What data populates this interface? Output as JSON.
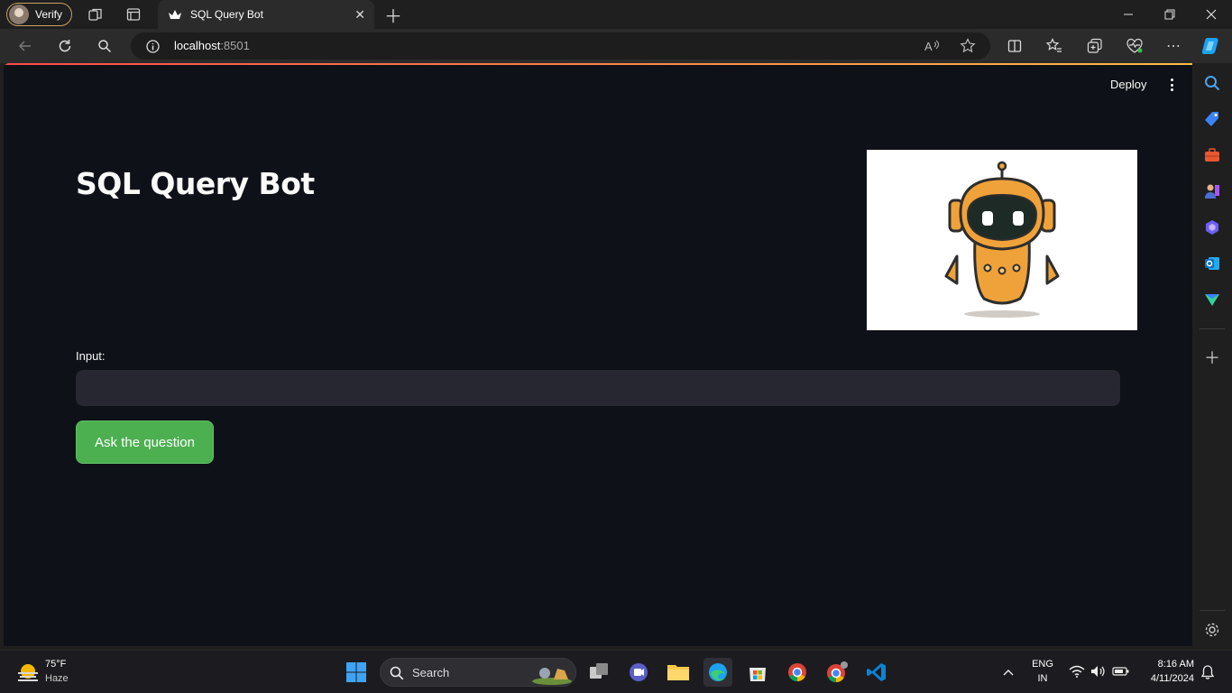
{
  "browser": {
    "profile_label": "Verify",
    "tab_title": "SQL Query Bot",
    "url_host": "localhost",
    "url_port": ":8501"
  },
  "app": {
    "deploy_label": "Deploy",
    "title": "SQL Query Bot",
    "input_label": "Input:",
    "input_value": "",
    "button_label": "Ask the question"
  },
  "taskbar": {
    "weather_temp": "75°F",
    "weather_desc": "Haze",
    "search_label": "Search",
    "lang_primary": "ENG",
    "lang_secondary": "IN",
    "time": "8:16 AM",
    "date": "4/11/2024"
  },
  "colors": {
    "page_bg": "#0e1117",
    "input_bg": "#262730",
    "button_bg": "#4caf50",
    "robot_orange": "#f0a23a"
  }
}
